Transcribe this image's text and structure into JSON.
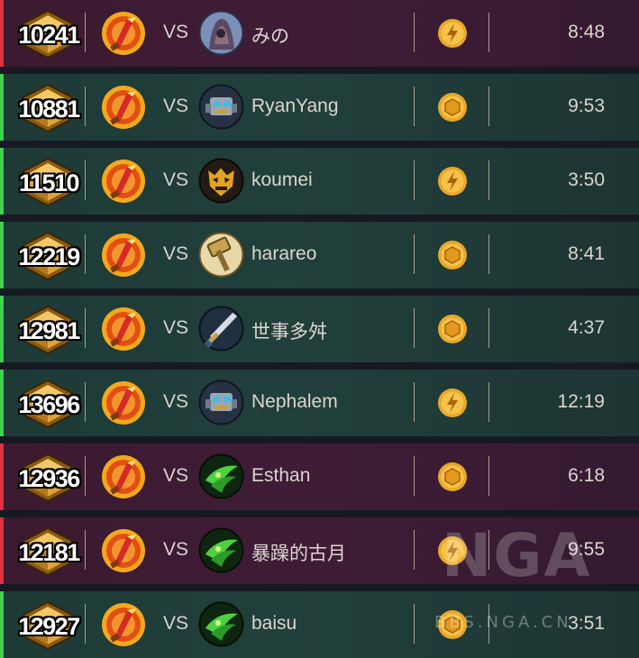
{
  "matches": [
    {
      "rank": "10241",
      "result": "loss",
      "vs": "VS",
      "opponent": "みの",
      "opponent_avatar": "hooded-figure-icon",
      "mode": "bolt",
      "time": "8:48"
    },
    {
      "rank": "10881",
      "result": "win",
      "vs": "VS",
      "opponent": "RyanYang",
      "opponent_avatar": "mech-icon",
      "mode": "coin",
      "time": "9:53"
    },
    {
      "rank": "11510",
      "result": "win",
      "vs": "VS",
      "opponent": "koumei",
      "opponent_avatar": "demon-mask-icon",
      "mode": "bolt",
      "time": "3:50"
    },
    {
      "rank": "12219",
      "result": "win",
      "vs": "VS",
      "opponent": "harareo",
      "opponent_avatar": "hammer-icon",
      "mode": "coin",
      "time": "8:41"
    },
    {
      "rank": "12981",
      "result": "win",
      "vs": "VS",
      "opponent": "世事多舛",
      "opponent_avatar": "sword-icon",
      "mode": "coin",
      "time": "4:37"
    },
    {
      "rank": "13696",
      "result": "win",
      "vs": "VS",
      "opponent": "Nephalem",
      "opponent_avatar": "mech-icon",
      "mode": "bolt",
      "time": "12:19"
    },
    {
      "rank": "12936",
      "result": "loss",
      "vs": "VS",
      "opponent": "Esthan",
      "opponent_avatar": "fel-icon",
      "mode": "coin",
      "time": "6:18"
    },
    {
      "rank": "12181",
      "result": "loss",
      "vs": "VS",
      "opponent": "暴躁的古月",
      "opponent_avatar": "fel-icon",
      "mode": "bolt",
      "time": "9:55"
    },
    {
      "rank": "12927",
      "result": "win",
      "vs": "VS",
      "opponent": "baisu",
      "opponent_avatar": "fel-icon",
      "mode": "coin",
      "time": "3:51"
    }
  ],
  "watermark": {
    "logo": "NGA",
    "site": "BBS.NGA.CN"
  },
  "colors": {
    "win": "#3ed34d",
    "loss": "#e0323f",
    "rank_badge": "#d99a2b",
    "mode_icon": "#e9a72a"
  }
}
